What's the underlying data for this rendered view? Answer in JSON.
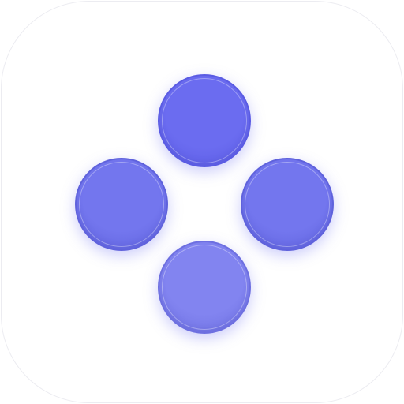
{
  "icon": {
    "background": "#ffffff",
    "border": "#ececf1",
    "dots": [
      {
        "position": "top",
        "fill": "#6b6cf0",
        "shade": "#5a5be3"
      },
      {
        "position": "left",
        "fill": "#7376ee",
        "shade": "#5f62dc"
      },
      {
        "position": "right",
        "fill": "#7376ee",
        "shade": "#5f62dc"
      },
      {
        "position": "bottom",
        "fill": "#8284f0",
        "shade": "#6d6fe0"
      }
    ],
    "glow": "rgba(110, 112, 240, 0.35)"
  }
}
